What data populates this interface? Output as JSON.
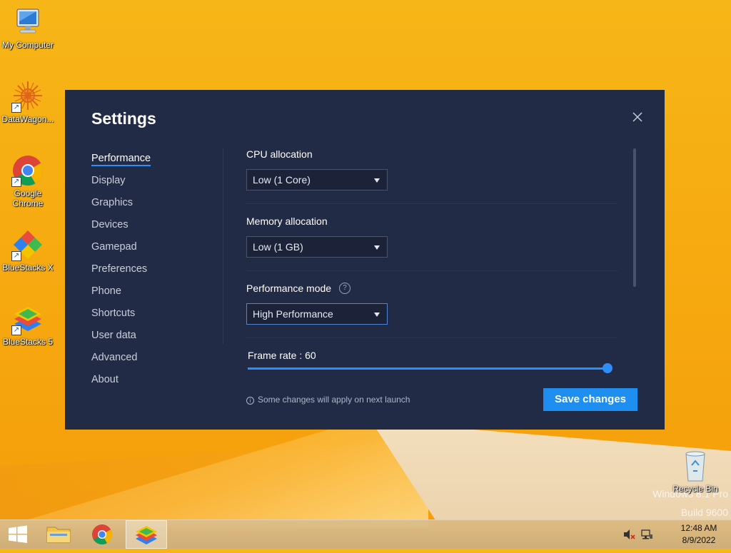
{
  "desktop": {
    "icons": [
      {
        "label": "My Computer"
      },
      {
        "label": "DataWagon..."
      },
      {
        "label": "Google Chrome"
      },
      {
        "label": "BlueStacks X"
      },
      {
        "label": "BlueStacks 5"
      },
      {
        "label": "Recycle Bin"
      }
    ],
    "watermark_line1": "Windows 8.1 Pro",
    "watermark_line2": "Build 9600"
  },
  "settings": {
    "title": "Settings",
    "nav": [
      {
        "label": "Performance",
        "active": true
      },
      {
        "label": "Display"
      },
      {
        "label": "Graphics"
      },
      {
        "label": "Devices"
      },
      {
        "label": "Gamepad"
      },
      {
        "label": "Preferences"
      },
      {
        "label": "Phone"
      },
      {
        "label": "Shortcuts"
      },
      {
        "label": "User data"
      },
      {
        "label": "Advanced"
      },
      {
        "label": "About"
      }
    ],
    "cpu": {
      "label": "CPU allocation",
      "value": "Low (1 Core)"
    },
    "memory": {
      "label": "Memory allocation",
      "value": "Low (1 GB)"
    },
    "perf_mode": {
      "label": "Performance mode",
      "value": "High Performance"
    },
    "frame_rate": {
      "label": "Frame rate : 60",
      "fraction": 1.0
    },
    "footer_note": "Some changes will apply on next launch",
    "save_label": "Save changes",
    "colors": {
      "accent": "#1e8ef0",
      "panel": "#222b45"
    }
  },
  "taskbar": {
    "time": "12:48 AM",
    "date": "8/9/2022"
  }
}
